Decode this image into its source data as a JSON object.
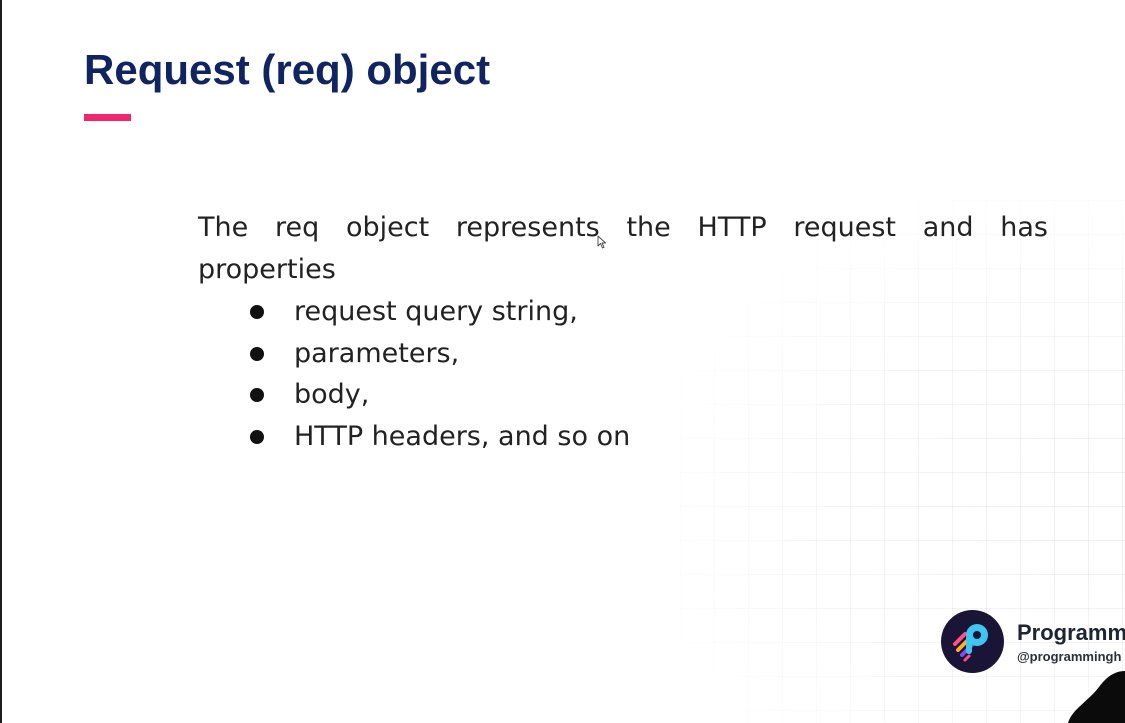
{
  "slide": {
    "title": "Request (req) object",
    "accent_color": "#f0266f",
    "title_color": "#0f2461",
    "intro": "The req object represents the HTTP request and has properties",
    "bullets": [
      "request query string,",
      "parameters,",
      "body,",
      "HTTP headers, and so on"
    ]
  },
  "brand": {
    "name": "Programm",
    "handle": "@programmingh",
    "logo_icon": "programiz-logo-icon"
  },
  "icons": {
    "cursor": "mouse-pointer-icon",
    "bullet": "bullet-dot-icon"
  }
}
